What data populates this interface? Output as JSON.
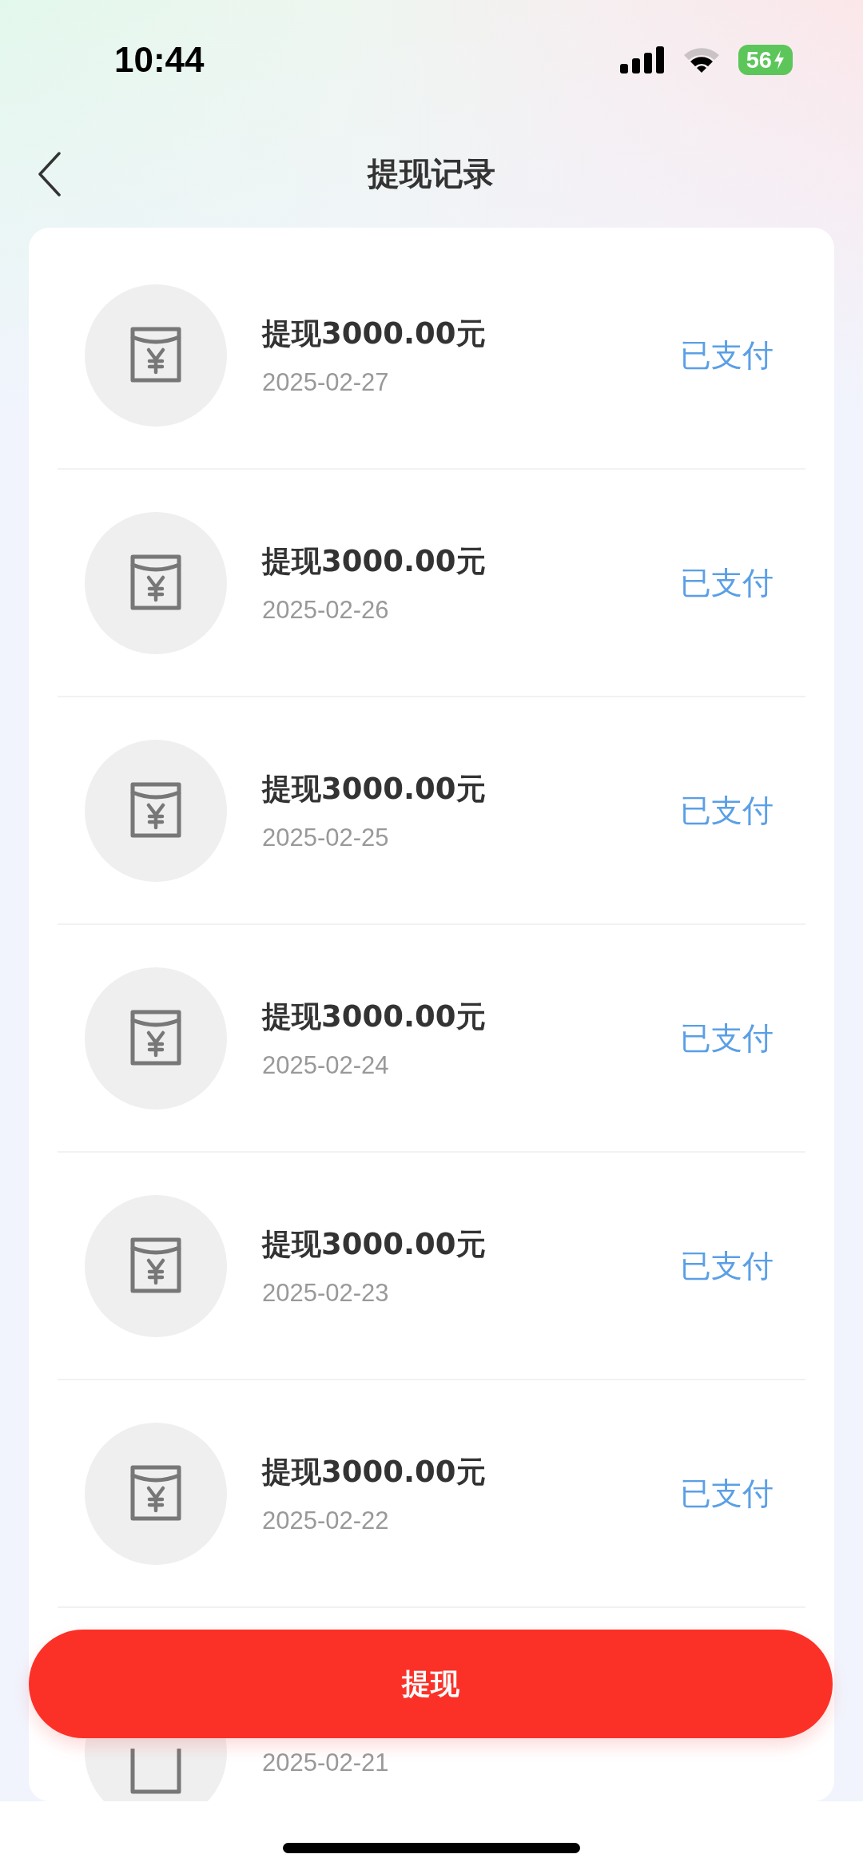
{
  "status_bar": {
    "time": "10:44",
    "battery": "56"
  },
  "nav": {
    "title": "提现记录"
  },
  "records": [
    {
      "title": "提现3000.00元",
      "date": "2025-02-27",
      "status": "已支付"
    },
    {
      "title": "提现3000.00元",
      "date": "2025-02-26",
      "status": "已支付"
    },
    {
      "title": "提现3000.00元",
      "date": "2025-02-25",
      "status": "已支付"
    },
    {
      "title": "提现3000.00元",
      "date": "2025-02-24",
      "status": "已支付"
    },
    {
      "title": "提现3000.00元",
      "date": "2025-02-23",
      "status": "已支付"
    },
    {
      "title": "提现3000.00元",
      "date": "2025-02-22",
      "status": "已支付"
    }
  ],
  "partial_record": {
    "date": "2025-02-21"
  },
  "withdraw_button": {
    "label": "提现"
  }
}
